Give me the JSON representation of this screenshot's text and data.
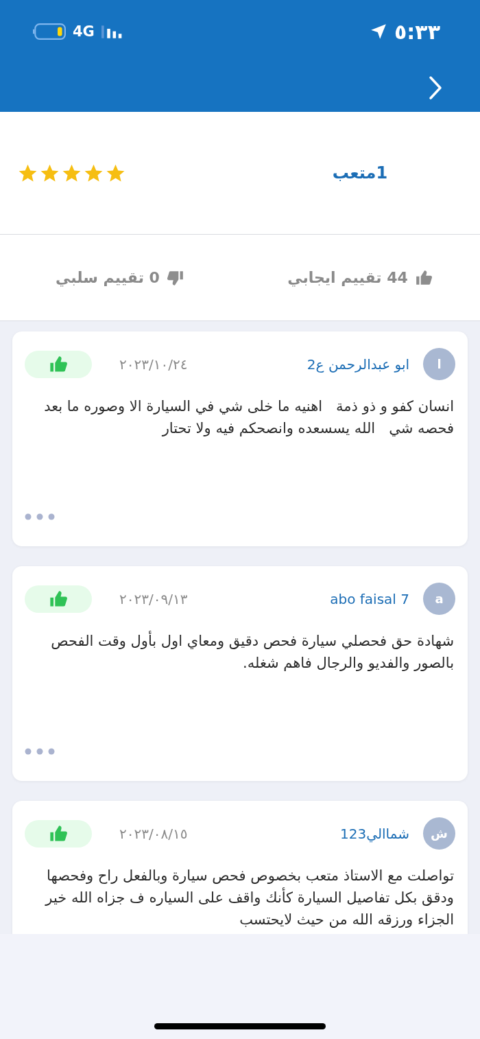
{
  "status_bar": {
    "time": "٥:٣٣",
    "network": "4G"
  },
  "profile": {
    "name": "1متعب",
    "stars": 5
  },
  "ratings": [
    {
      "kind": "positive",
      "text": "44 تقييم ايجابي"
    },
    {
      "kind": "negative",
      "text": "0 تقييم سلبي"
    }
  ],
  "reviews": [
    {
      "avatar": "ا",
      "author": "ابو عبدالرحمن ع2",
      "date": "٢٠٢٣/١٠/٢٤",
      "kind": "positive",
      "more_button": true,
      "text": "انسان كفو و ذو ذمة   اهنيه ما خلى شي في السيارة الا وصوره ما بعد فحصه شي   الله يسسعده وانصحكم فيه ولا تحتار"
    },
    {
      "avatar": "a",
      "author": "abo faisal 7",
      "date": "٢٠٢٣/٠٩/١٣",
      "kind": "positive",
      "more_button": true,
      "text": "شهادة حق فحصلي سيارة فحص دقيق ومعاي اول بأول وقت الفحص بالصور والفديو والرجال فاهم شغله."
    },
    {
      "avatar": "ش",
      "author": "شماالي123",
      "date": "٢٠٢٣/٠٨/١٥",
      "kind": "positive",
      "text": "تواصلت مع الاستاذ متعب بخصوص فحص سيارة وبالفعل راح وفحصها ودقق بكل تفاصيل السيارة كأنك واقف على السياره ف جزاه الله خير الجزاء ورزقه الله من حيث لايحتسب"
    }
  ]
}
